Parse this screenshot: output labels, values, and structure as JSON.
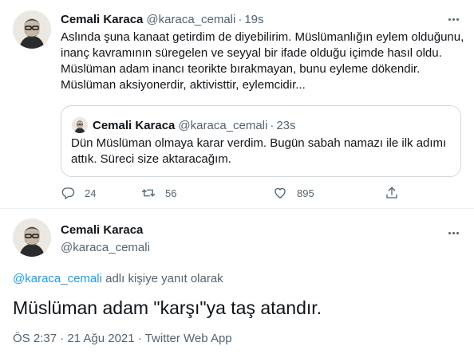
{
  "tweet": {
    "author": {
      "name": "Cemali Karaca",
      "handle": "@karaca_cemali"
    },
    "separator": "·",
    "time": "19s",
    "text_lines": [
      "Aslında şuna kanaat getirdim de diyebilirim. Müslümanlığın eylem olduğunu,",
      "inanç kavramının süregelen ve seyyal bir ifade olduğu içimde hasıl oldu.",
      "Müslüman adam inancı teorikte bırakmayan, bunu eyleme dökendir.",
      "Müslüman aksiyonerdir, aktivisttir, eylemcidir..."
    ],
    "quoted": {
      "name": "Cemali Karaca",
      "handle": "@karaca_cemali",
      "time": "23s",
      "text_lines": [
        "Dün Müslüman olmaya karar verdim. Bugün sabah namazı ile ilk adımı",
        "attık. Süreci size aktaracağım."
      ]
    },
    "actions": {
      "replies": "24",
      "retweets": "56",
      "likes": "895"
    }
  },
  "reply": {
    "author": {
      "name": "Cemali Karaca",
      "handle": "@karaca_cemali"
    },
    "reply_to_handle": "@karaca_cemali",
    "reply_to_suffix": " adlı kişiye yanıt olarak",
    "text": "Müslüman adam \"karşı\"ya taş atandır.",
    "timestamp": "ÖS 2:37 · 21 Ağu 2021 · ",
    "source": "Twitter Web App"
  },
  "icons": [
    "reply-icon",
    "retweet-icon",
    "like-icon",
    "share-icon",
    "more-icon"
  ],
  "colors": {
    "text": "#0f1419",
    "secondary": "#536471",
    "link": "#1d9bf0",
    "border": "#cfd9de"
  }
}
